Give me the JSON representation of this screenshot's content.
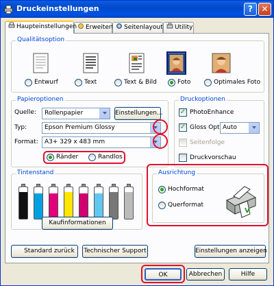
{
  "window": {
    "title": "Druckeinstellungen",
    "help_label": "?",
    "close_label": "✕"
  },
  "tabs": [
    {
      "label": "Haupteinstellungen",
      "icon": "printer-settings-icon"
    },
    {
      "label": "Erweitert",
      "icon": "advanced-icon"
    },
    {
      "label": "Seitenlayout",
      "icon": "page-layout-icon"
    },
    {
      "label": "Utility",
      "icon": "utility-icon"
    }
  ],
  "quality": {
    "title": "Qualitätsoption",
    "options": [
      {
        "label": "Entwurf",
        "selected": false
      },
      {
        "label": "Text",
        "selected": false
      },
      {
        "label": "Text & Bild",
        "selected": false
      },
      {
        "label": "Foto",
        "selected": true
      },
      {
        "label": "Optimales Foto",
        "selected": false
      }
    ]
  },
  "paper": {
    "title": "Papieroptionen",
    "source_label": "Quelle:",
    "source_value": "Rollenpapier",
    "settings_button": "Einstellungen...",
    "type_label": "Typ:",
    "type_value": "Epson Premium Glossy",
    "format_label": "Format:",
    "format_value": "A3+ 329 x 483 mm",
    "margins_label": "Ränder",
    "borderless_label": "Randlos"
  },
  "print_options": {
    "title": "Druckoptionen",
    "photo_enhance": "PhotoEnhance",
    "gloss_label": "Gloss Opt.",
    "gloss_value": "Auto",
    "page_order": "Seitenfolge",
    "preview": "Druckvorschau"
  },
  "ink": {
    "title": "Tintenstand",
    "cartridges": [
      {
        "color": "#111111",
        "level": 0.85
      },
      {
        "color": "#00a0e0",
        "level": 0.8
      },
      {
        "color": "#e0007a",
        "level": 0.8
      },
      {
        "color": "#ffe600",
        "level": 0.85
      },
      {
        "color": "#d0006f",
        "level": 0.8
      },
      {
        "color": "#60c8f0",
        "level": 0.8
      },
      {
        "color": "#777777",
        "level": 0.85
      },
      {
        "color": "#bbbbbb",
        "level": 0.85
      }
    ],
    "purchase_button": "Kaufinformationen"
  },
  "orientation": {
    "title": "Ausrichtung",
    "portrait": "Hochformat",
    "landscape": "Querformat"
  },
  "bottom": {
    "default_button": "Standard zurück",
    "support_button": "Technischer Support",
    "show_settings_button": "Einstellungen anzeigen"
  },
  "dialog": {
    "ok": "OK",
    "cancel": "Abbrechen",
    "help": "Hilfe"
  },
  "colors": {
    "accent": "#0046d5",
    "highlight": "#e0102c"
  }
}
